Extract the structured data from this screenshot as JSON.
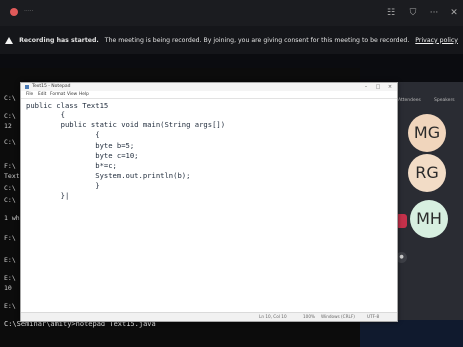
{
  "teams": {
    "toolbar_icons": [
      "people-icon",
      "shield-icon",
      "more-icon",
      "close-icon"
    ],
    "banner": {
      "title": "Recording has started.",
      "message": "The meeting is being recorded. By joining, you are giving consent for this meeting to be recorded.",
      "link": "Privacy policy"
    }
  },
  "cmd": {
    "prompt_lines": [
      "C:\\",
      "C:\\",
      "12",
      "C:\\",
      "F:\\",
      "Text",
      "C:\\",
      "C:\\",
      "1 wh",
      "F:\\",
      "E:\\",
      "E:\\",
      "10",
      "E:\\"
    ],
    "command": "C:\\Seminar\\amity>notepad Text15.java"
  },
  "notepad": {
    "title": "Text15 - Notepad",
    "menu": [
      "File",
      "Edit",
      "Format",
      "View",
      "Help"
    ],
    "code": [
      "public class Text15",
      "        {",
      "        public static void main(String args[])",
      "                {",
      "                byte b=5;",
      "                byte c=10;",
      "                b*=c;",
      "                System.out.println(b);",
      "                }",
      "        }|"
    ],
    "status": {
      "position": "Ln 10, Col 10",
      "zoom": "100%",
      "line_ending": "Windows (CRLF)",
      "encoding": "UTF-8"
    }
  },
  "participants": {
    "header_left": "Attendees",
    "header_right": "Speakers",
    "avatars": [
      {
        "initials": "MG",
        "color": "#f0d5bc"
      },
      {
        "initials": "RG",
        "color": "#f2dcc6"
      },
      {
        "initials": "MH",
        "color": "#d7efe0"
      }
    ]
  }
}
